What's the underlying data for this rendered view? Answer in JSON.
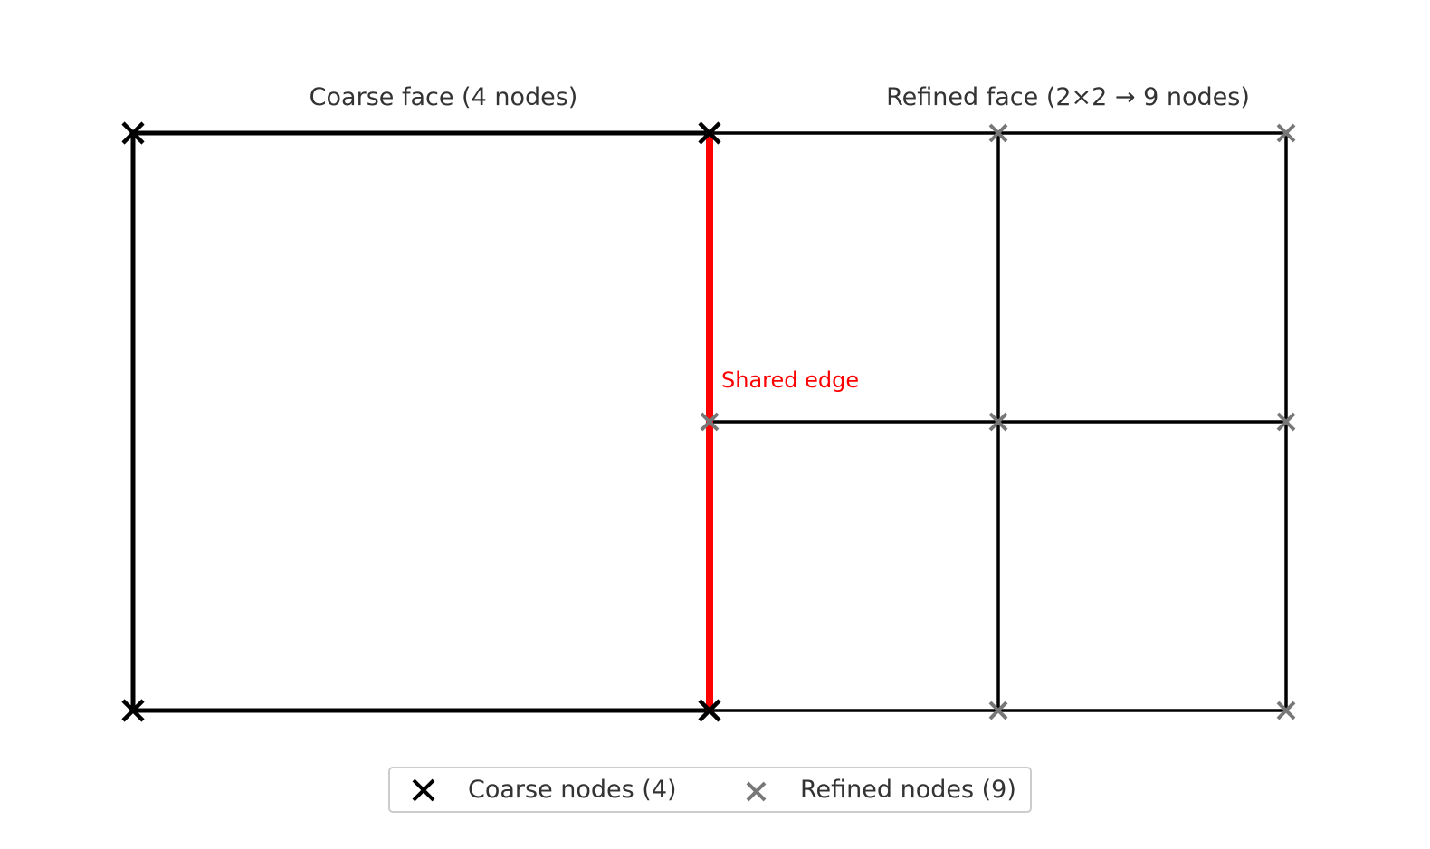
{
  "titles": {
    "coarse": "Coarse face (4 nodes)",
    "refined": "Refined face (2×2 → 9 nodes)"
  },
  "shared_edge": {
    "label": "Shared edge",
    "color": "#ff0000"
  },
  "legend": {
    "coarse_label": "Coarse nodes (4)",
    "refined_label": "Refined nodes (9)"
  },
  "colors": {
    "coarse_node": "#000000",
    "refined_node": "#777777",
    "edge": "#000000",
    "text": "#333333"
  },
  "mesh": {
    "coarse_nodes": 4,
    "refined_grid": "2×2",
    "refined_nodes": 9
  }
}
